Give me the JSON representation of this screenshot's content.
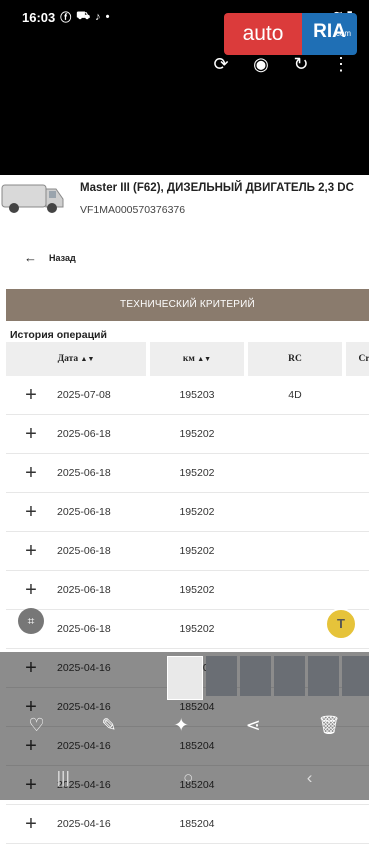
{
  "status": {
    "time": "16:03",
    "signal": "VoLTE"
  },
  "logo": {
    "auto": "auto",
    "ria": "RIA",
    "com": ".com"
  },
  "vehicle": {
    "title": "Master III (F62), ДИЗЕЛЬНЫЙ ДВИГАТЕЛЬ 2,3 DC",
    "vin": "VF1MA000570376376"
  },
  "back_label": "Назад",
  "section_bar": "ТЕХНИЧЕСКИЙ КРИТЕРИЙ",
  "history_label": "История операций",
  "table": {
    "headers": {
      "date": "Дата",
      "km": "км",
      "rc": "RC",
      "next": "Cr"
    },
    "rows": [
      {
        "date": "2025-07-08",
        "km": "195203",
        "rc": "4D"
      },
      {
        "date": "2025-06-18",
        "km": "195202",
        "rc": ""
      },
      {
        "date": "2025-06-18",
        "km": "195202",
        "rc": ""
      },
      {
        "date": "2025-06-18",
        "km": "195202",
        "rc": ""
      },
      {
        "date": "2025-06-18",
        "km": "195202",
        "rc": ""
      },
      {
        "date": "2025-06-18",
        "km": "195202",
        "rc": ""
      },
      {
        "date": "2025-06-18",
        "km": "195202",
        "rc": ""
      },
      {
        "date": "2025-04-16",
        "km": "185204",
        "rc": ""
      },
      {
        "date": "2025-04-16",
        "km": "185204",
        "rc": ""
      },
      {
        "date": "2025-04-16",
        "km": "185204",
        "rc": ""
      },
      {
        "date": "2025-04-16",
        "km": "185204",
        "rc": ""
      },
      {
        "date": "2025-04-16",
        "km": "185204",
        "rc": ""
      }
    ]
  },
  "float_badge": "T"
}
